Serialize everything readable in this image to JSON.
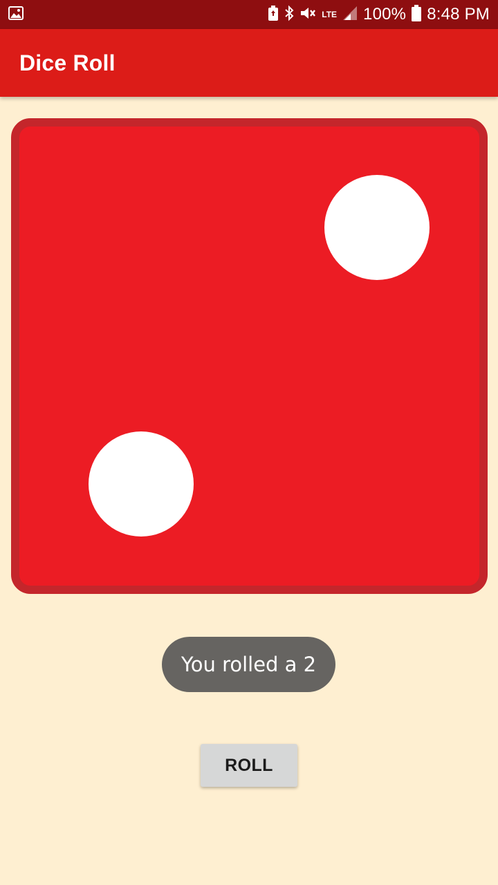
{
  "status_bar": {
    "battery_percent": "100%",
    "time": "8:48 PM",
    "network": "LTE",
    "icons": [
      "image-icon",
      "battery-saver-icon",
      "bluetooth-icon",
      "mute-icon",
      "lte-icon",
      "signal-icon",
      "battery-icon"
    ]
  },
  "app_bar": {
    "title": "Dice Roll"
  },
  "die": {
    "value": 2,
    "face_color": "#EC1C24",
    "border_color": "#C4262B",
    "pip_color": "#FFFFFF"
  },
  "toast": {
    "message": "You rolled a 2"
  },
  "roll_button": {
    "label": "ROLL"
  },
  "colors": {
    "background": "#FEEFD1",
    "app_bar": "#DC1C18",
    "status_bar": "#8E0E10"
  }
}
